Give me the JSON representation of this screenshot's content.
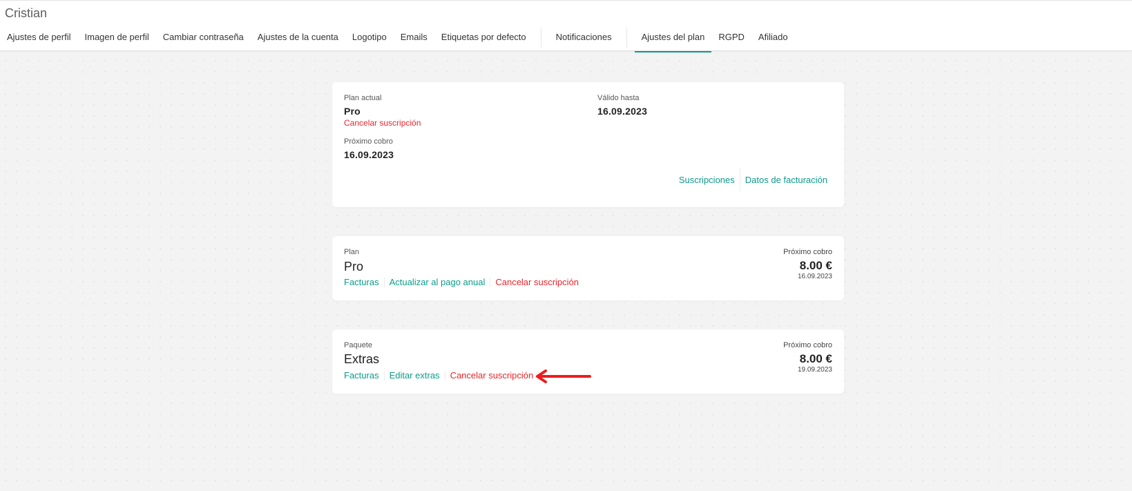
{
  "header": {
    "user_name": "Cristian",
    "tabs": [
      {
        "label": "Ajustes de perfil"
      },
      {
        "label": "Imagen de perfil"
      },
      {
        "label": "Cambiar contraseña"
      },
      {
        "label": "Ajustes de la cuenta"
      },
      {
        "label": "Logotipo"
      },
      {
        "label": "Emails"
      },
      {
        "label": "Etiquetas por defecto"
      },
      {
        "label": "Notificaciones"
      },
      {
        "label": "Ajustes del plan"
      },
      {
        "label": "RGPD"
      },
      {
        "label": "Afiliado"
      }
    ],
    "active_tab": "Ajustes del plan"
  },
  "summary": {
    "current_plan_label": "Plan actual",
    "current_plan_value": "Pro",
    "cancel_link": "Cancelar suscripción",
    "valid_until_label": "Válido hasta",
    "valid_until_value": "16.09.2023",
    "next_charge_label": "Próximo cobro",
    "next_charge_value": "16.09.2023",
    "subscriptions_link": "Suscripciones",
    "billing_link": "Datos de facturación"
  },
  "plan_card": {
    "label": "Plan",
    "title": "Pro",
    "links": {
      "invoices": "Facturas",
      "upgrade": "Actualizar al pago anual",
      "cancel": "Cancelar suscripción"
    },
    "next_charge_label": "Próximo cobro",
    "price": "8.00 €",
    "date": "16.09.2023"
  },
  "package_card": {
    "label": "Paquete",
    "title": "Extras",
    "links": {
      "invoices": "Facturas",
      "edit": "Editar extras",
      "cancel": "Cancelar suscripción"
    },
    "next_charge_label": "Próximo cobro",
    "price": "8.00 €",
    "date": "19.09.2023"
  },
  "colors": {
    "accent": "#0a9b8c",
    "danger": "#e8252b",
    "annotation_arrow": "#ee1c1c"
  }
}
